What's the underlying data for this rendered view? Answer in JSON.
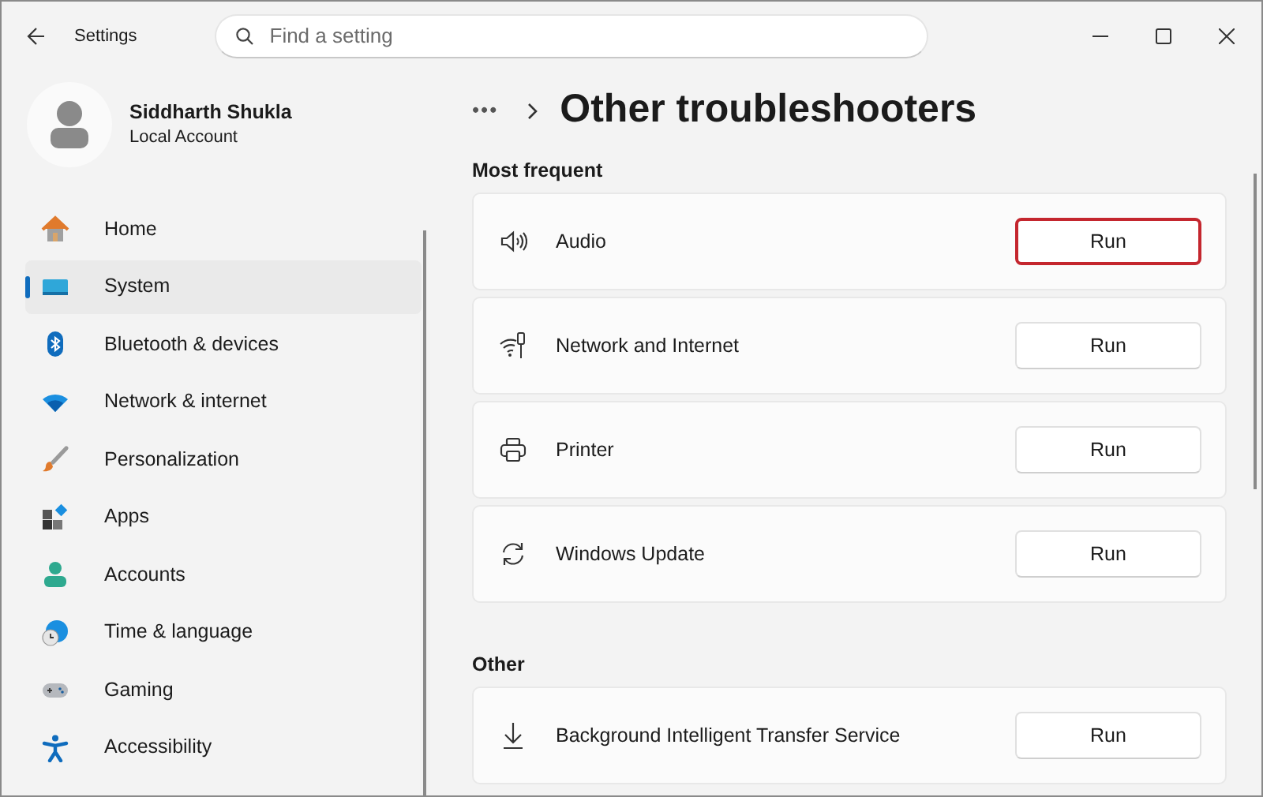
{
  "window": {
    "title": "Settings"
  },
  "search": {
    "placeholder": "Find a setting"
  },
  "profile": {
    "name": "Siddharth Shukla",
    "account": "Local Account"
  },
  "sidebar": {
    "items": [
      {
        "label": "Home",
        "selected": false
      },
      {
        "label": "System",
        "selected": true
      },
      {
        "label": "Bluetooth & devices",
        "selected": false
      },
      {
        "label": "Network & internet",
        "selected": false
      },
      {
        "label": "Personalization",
        "selected": false
      },
      {
        "label": "Apps",
        "selected": false
      },
      {
        "label": "Accounts",
        "selected": false
      },
      {
        "label": "Time & language",
        "selected": false
      },
      {
        "label": "Gaming",
        "selected": false
      },
      {
        "label": "Accessibility",
        "selected": false
      }
    ]
  },
  "breadcrumb": {
    "overflow": "•••",
    "title": "Other troubleshooters"
  },
  "sections": [
    {
      "heading": "Most frequent",
      "items": [
        {
          "label": "Audio",
          "button": "Run",
          "highlighted": true
        },
        {
          "label": "Network and Internet",
          "button": "Run",
          "highlighted": false
        },
        {
          "label": "Printer",
          "button": "Run",
          "highlighted": false
        },
        {
          "label": "Windows Update",
          "button": "Run",
          "highlighted": false
        }
      ]
    },
    {
      "heading": "Other",
      "items": [
        {
          "label": "Background Intelligent Transfer Service",
          "button": "Run",
          "highlighted": false
        }
      ]
    }
  ]
}
